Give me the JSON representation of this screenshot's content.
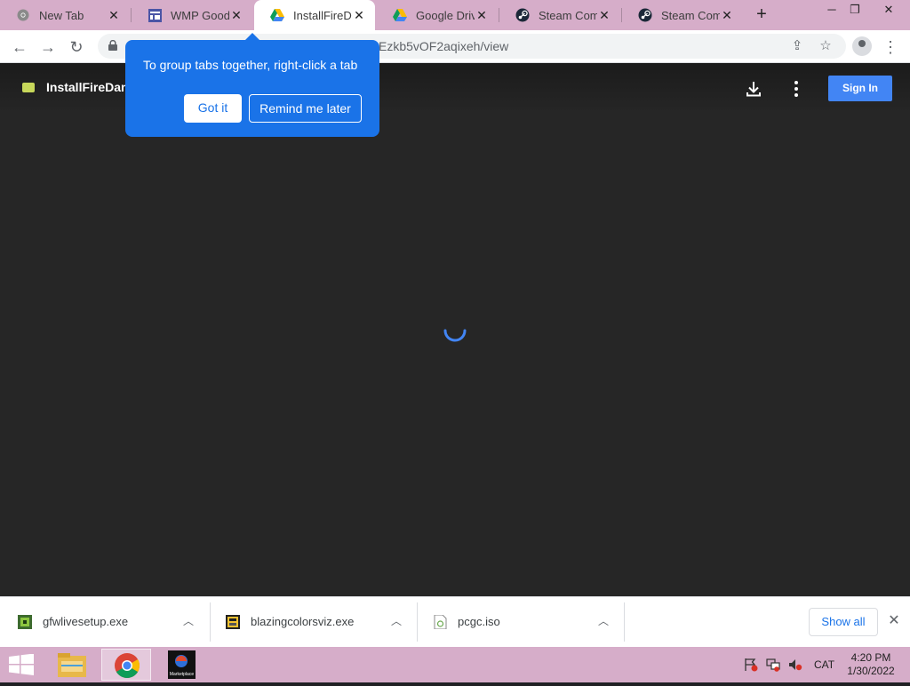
{
  "tabs": [
    {
      "title": "New Tab",
      "icon": "chrome-icon"
    },
    {
      "title": "WMP Goodies",
      "icon": "site-icon"
    },
    {
      "title": "InstallFireDance",
      "icon": "google-drive-icon"
    },
    {
      "title": "Google Drive",
      "icon": "google-drive-icon"
    },
    {
      "title": "Steam Community",
      "icon": "steam-icon"
    },
    {
      "title": "Steam Community",
      "icon": "steam-icon"
    }
  ],
  "toolbar": {
    "url": "Ezkb5vOF2aqixeh/view"
  },
  "tooltip": {
    "text": "To group tabs together, right-click a tab",
    "got_it": "Got it",
    "remind": "Remind me later"
  },
  "viewer": {
    "file_title": "InstallFireDance",
    "sign_in": "Sign In"
  },
  "downloads": {
    "items": [
      {
        "name": "gfwlivesetup.exe"
      },
      {
        "name": "blazingcolorsviz.exe"
      },
      {
        "name": "pcgc.iso"
      }
    ],
    "show_all": "Show all"
  },
  "taskbar": {
    "language": "CAT",
    "time": "4:20 PM",
    "date": "1/30/2022",
    "marketplace_label": "Marketplace"
  },
  "colors": {
    "accent": "#1a73e8",
    "chrome_frame": "#d6adc9",
    "viewer_bg": "#262626",
    "sign_in": "#4285f4"
  }
}
